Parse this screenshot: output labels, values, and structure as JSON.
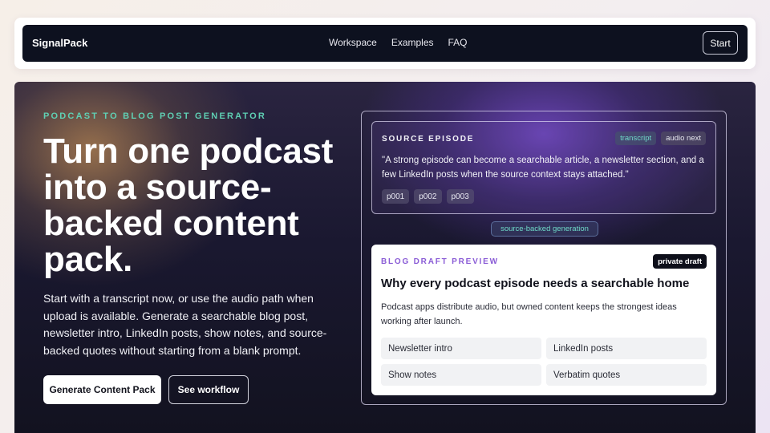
{
  "nav": {
    "brand": "SignalPack",
    "links": [
      "Workspace",
      "Examples",
      "FAQ"
    ],
    "start_label": "Start"
  },
  "hero": {
    "eyebrow": "PODCAST TO BLOG POST GENERATOR",
    "headline": "Turn one podcast into a source-backed content pack.",
    "lead": "Start with a transcript now, or use the audio path when upload is available. Generate a searchable blog post, newsletter intro, LinkedIn posts, show notes, and source-backed quotes without starting from a blank prompt.",
    "primary_cta": "Generate Content Pack",
    "secondary_cta": "See workflow"
  },
  "source": {
    "title": "SOURCE EPISODE",
    "chips": [
      "transcript",
      "audio next"
    ],
    "quote": "\"A strong episode can become a searchable article, a newsletter section, and a few LinkedIn posts when the source context stays attached.\"",
    "refs": [
      "p001",
      "p002",
      "p003"
    ]
  },
  "connector_label": "source-backed generation",
  "draft": {
    "label": "BLOG DRAFT PREVIEW",
    "badge": "private draft",
    "title": "Why every podcast episode needs a searchable home",
    "body": "Podcast apps distribute audio, but owned content keeps the strongest ideas working after launch.",
    "outputs": [
      "Newsletter intro",
      "LinkedIn posts",
      "Show notes",
      "Verbatim quotes"
    ]
  }
}
